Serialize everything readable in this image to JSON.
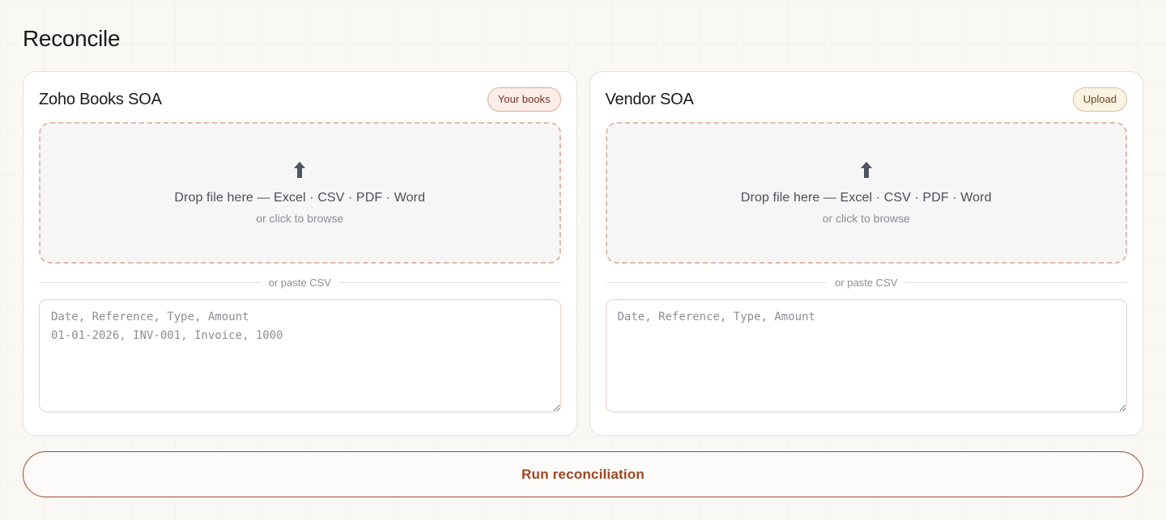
{
  "page": {
    "title": "Reconcile"
  },
  "panels": {
    "books": {
      "title": "Zoho Books SOA",
      "badge": "Your books",
      "dropzone": {
        "icon": "upload-arrow-icon",
        "primary": "Drop file here — Excel · CSV · PDF · Word",
        "secondary": "or click to browse"
      },
      "divider": "or paste CSV",
      "csv": {
        "value": "",
        "placeholder": "Date, Reference, Type, Amount\n01-01-2026, INV-001, Invoice, 1000"
      }
    },
    "vendor": {
      "title": "Vendor SOA",
      "badge": "Upload",
      "dropzone": {
        "icon": "upload-arrow-icon",
        "primary": "Drop file here — Excel · CSV · PDF · Word",
        "secondary": "or click to browse"
      },
      "divider": "or paste CSV",
      "csv": {
        "value": "",
        "placeholder": "Date, Reference, Type, Amount"
      }
    }
  },
  "actions": {
    "run_label": "Run reconciliation"
  },
  "colors": {
    "accent": "#a0461f",
    "dropzone_border": "#e2b8a9",
    "icon": "#4d5562"
  }
}
